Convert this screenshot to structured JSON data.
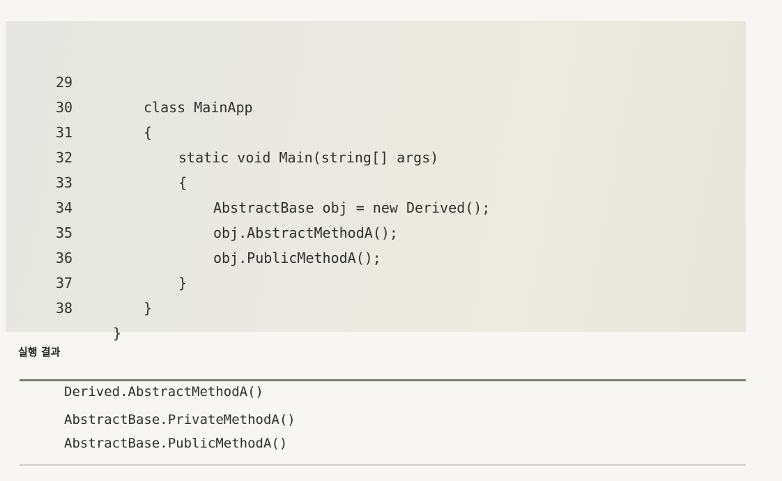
{
  "code": {
    "lines": [
      {
        "num": "29",
        "text": "class MainApp"
      },
      {
        "num": "30",
        "text": "{"
      },
      {
        "num": "31",
        "text": "static void Main(string[] args)"
      },
      {
        "num": "32",
        "text": "{"
      },
      {
        "num": "33",
        "text": "AbstractBase obj = new Derived();"
      },
      {
        "num": "34",
        "text": "obj.AbstractMethodA();"
      },
      {
        "num": "35",
        "text": "obj.PublicMethodA();"
      },
      {
        "num": "36",
        "text": "}"
      },
      {
        "num": "37",
        "text": "}"
      },
      {
        "num": "38",
        "text": "}"
      }
    ]
  },
  "result": {
    "title": "실행 결과",
    "lines": [
      "Derived.AbstractMethodA()",
      "AbstractBase.PrivateMethodA()",
      "AbstractBase.PublicMethodA()"
    ]
  }
}
